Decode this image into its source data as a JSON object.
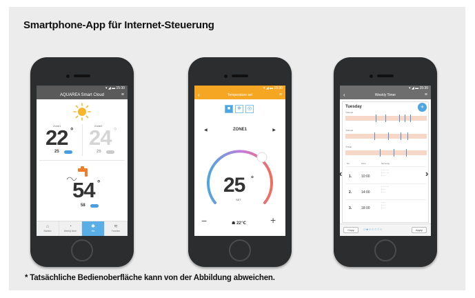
{
  "heading": "Smartphone-App für Internet-Steuerung",
  "footnote": "* Tatsächliche Bedienoberfläche kann von der Abbildung abweichen.",
  "status_bar": "▾ ◢ ▬ 15:30",
  "phone1": {
    "title": "AQUAREA Smart Cloud",
    "zone1_label": "Zone1",
    "zone2_label": "Zone2",
    "zone1_temp": "22",
    "zone2_temp": "24",
    "zone1_set": "25",
    "zone2_set": "26",
    "tank_temp": "54",
    "tank_set": "58",
    "tabs": [
      {
        "icon": "house-icon",
        "glyph": "⌂",
        "label": "Statistic"
      },
      {
        "icon": "timer-icon",
        "glyph": "◔",
        "label": "Weekly timer"
      },
      {
        "icon": "settings-icon",
        "glyph": "✱",
        "label": "Set"
      },
      {
        "icon": "graph-icon",
        "glyph": "≋",
        "label": "Function"
      }
    ]
  },
  "phone2": {
    "title": "Temperature set",
    "zone": "ZONE1",
    "set_temp": "25",
    "set_label": "SET",
    "room_temp": "22℃",
    "dial_colors": [
      "#4ea6e0",
      "#f26d5b",
      "#f5a623"
    ]
  },
  "phone3": {
    "title": "Weekly Timer",
    "day": "Tuesday",
    "timeline_labels": [
      "①Zone1",
      "②Zone2",
      "③Tank"
    ],
    "table_headers": [
      "No.",
      "Time",
      "Set temp."
    ],
    "rows": [
      {
        "no": "1.",
        "time": "10:00"
      },
      {
        "no": "2.",
        "time": "14:00"
      },
      {
        "no": "3.",
        "time": "18:00"
      }
    ],
    "copy_label": "Copy",
    "apply_label": "Apply"
  }
}
